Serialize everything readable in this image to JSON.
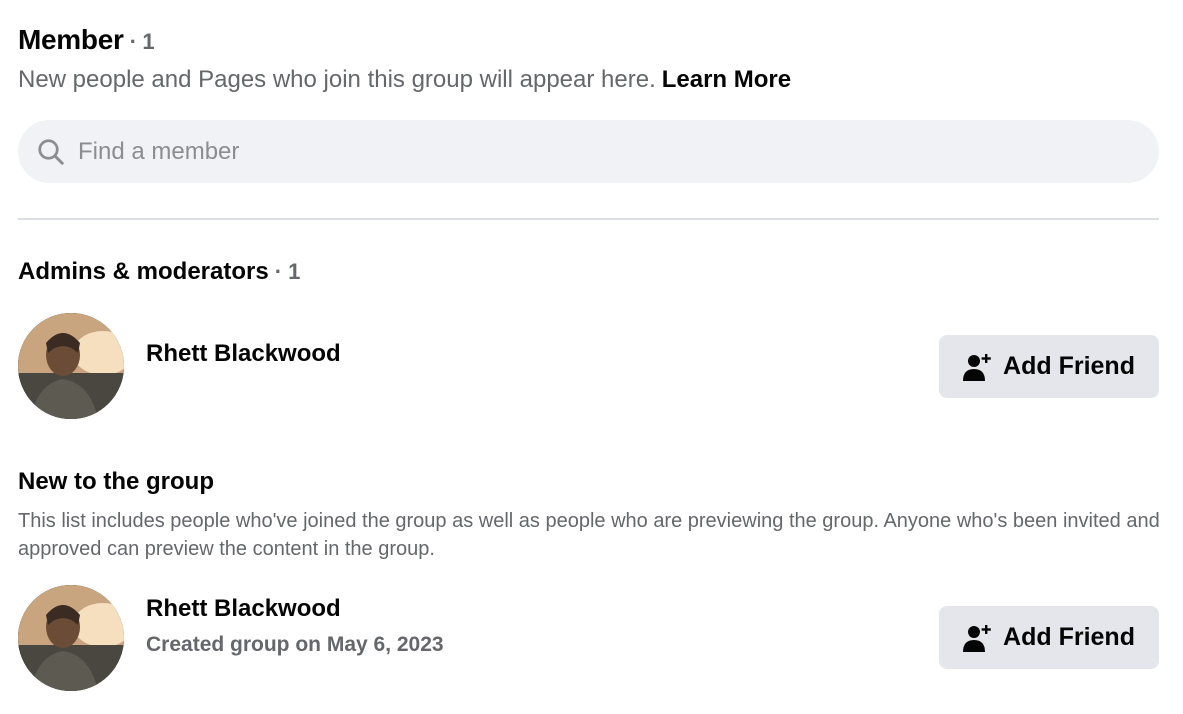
{
  "members": {
    "title": "Member",
    "count": "· 1",
    "description": "New people and Pages who join this group will appear here.",
    "learn_more": "Learn More"
  },
  "search": {
    "placeholder": "Find a member",
    "icon": "search-icon"
  },
  "admins": {
    "title": "Admins & moderators",
    "count": "· 1",
    "people": [
      {
        "name": "Rhett Blackwood",
        "button": "Add Friend",
        "icon": "add-friend-icon"
      }
    ]
  },
  "new_to_group": {
    "title": "New to the group",
    "description": "This list includes people who've joined the group as well as people who are previewing the group. Anyone who's been invited and approved can preview the content in the group.",
    "people": [
      {
        "name": "Rhett Blackwood",
        "subtitle": "Created group on May 6, 2023",
        "button": "Add Friend",
        "icon": "add-friend-icon"
      }
    ]
  },
  "colors": {
    "secondary_text": "#65676b",
    "button_bg": "#e4e6eb",
    "search_bg": "#f0f2f5"
  }
}
